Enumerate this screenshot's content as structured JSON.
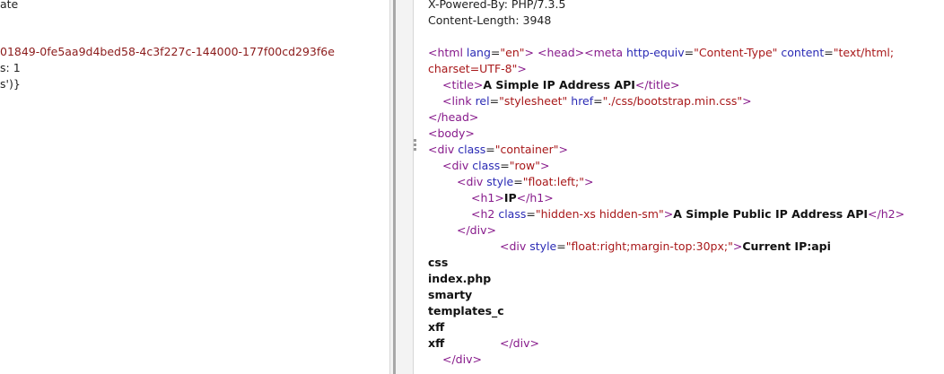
{
  "left": {
    "line1": "ate",
    "line2": "01849-0fe5aa9d4bed58-4c3f227c-144000-177f00cd293f6e",
    "line3": "s: 1",
    "line4": "s')}"
  },
  "headers": {
    "powered_by": "X-Powered-By: PHP/7.3.5",
    "content_length": "Content-Length: 3948"
  },
  "source": {
    "html_open": "<html",
    "lang_attr": " lang",
    "lang_val": "\"en\"",
    "head_open": "<head>",
    "meta_open": "<meta",
    "http_equiv_attr": " http-equiv",
    "http_equiv_val": "\"Content-Type\"",
    "content_attr": " content",
    "content_val_1": "\"text/html;",
    "content_val_2": "charset=UTF-8\"",
    "close_angle": ">",
    "title_open": "<title>",
    "title_text": "A Simple IP Address API",
    "title_close": "</title>",
    "link_open": "<link",
    "rel_attr": " rel",
    "rel_val": "\"stylesheet\"",
    "href_attr": " href",
    "href_val": "\"./css/bootstrap.min.css\"",
    "head_close": "</head>",
    "body_open": "<body>",
    "div_open": "<div",
    "class_attr": " class",
    "container_val": "\"container\"",
    "row_val": "\"row\"",
    "style_attr": " style",
    "float_left_val": "\"float:left;\"",
    "h1_open": "<h1>",
    "h1_text": "IP",
    "h1_close": "</h1>",
    "h2_open": "<h2",
    "h2_class_val": "\"hidden-xs hidden-sm\"",
    "h2_text": "A Simple Public IP Address API",
    "h2_close": "</h2>",
    "div_close": "</div>",
    "float_right_val": "\"float:right;margin-top:30px;\"",
    "current_ip": "Current IP:api",
    "eq": "="
  },
  "listing": [
    "css",
    "index.php",
    "smarty",
    "templates_c",
    "xff",
    "xff"
  ]
}
